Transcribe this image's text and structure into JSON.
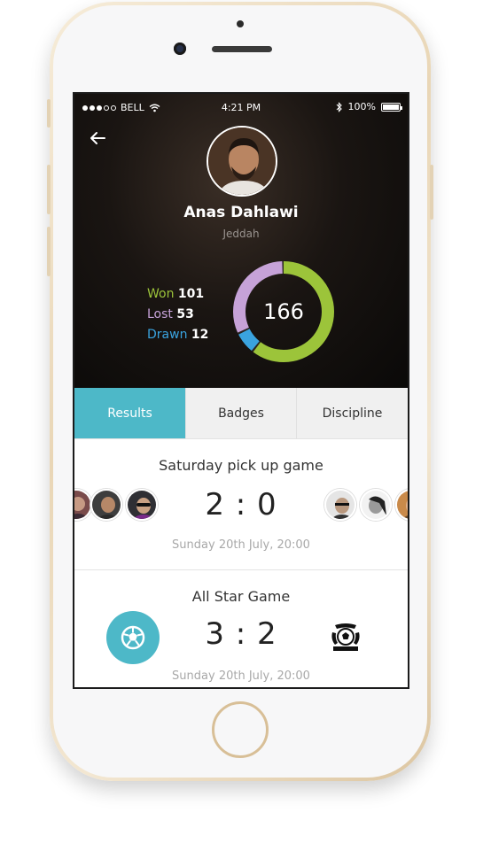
{
  "status_bar": {
    "carrier": "BELL",
    "time": "4:21 PM",
    "battery": "100%"
  },
  "profile": {
    "name": "Anas Dahlawi",
    "city": "Jeddah"
  },
  "stats": {
    "won_label": "Won",
    "won": "101",
    "lost_label": "Lost",
    "lost": "53",
    "drawn_label": "Drawn",
    "drawn": "12",
    "total": "166",
    "won_color": "#9cc43a",
    "lost_color": "#c6a2d8",
    "drawn_color": "#3aa3df"
  },
  "tabs": [
    {
      "label": "Results",
      "active": true
    },
    {
      "label": "Badges",
      "active": false
    },
    {
      "label": "Discipline",
      "active": false
    }
  ],
  "matches": [
    {
      "title": "Saturday pick up game",
      "score": "2 : 0",
      "date": "Sunday 20th July, 20:00"
    },
    {
      "title": "All Star Game",
      "score": "3 : 2",
      "date": "Sunday 20th July, 20:00"
    }
  ],
  "colors": {
    "accent": "#4db8c8",
    "phone_gold": "#e9d6b6"
  }
}
